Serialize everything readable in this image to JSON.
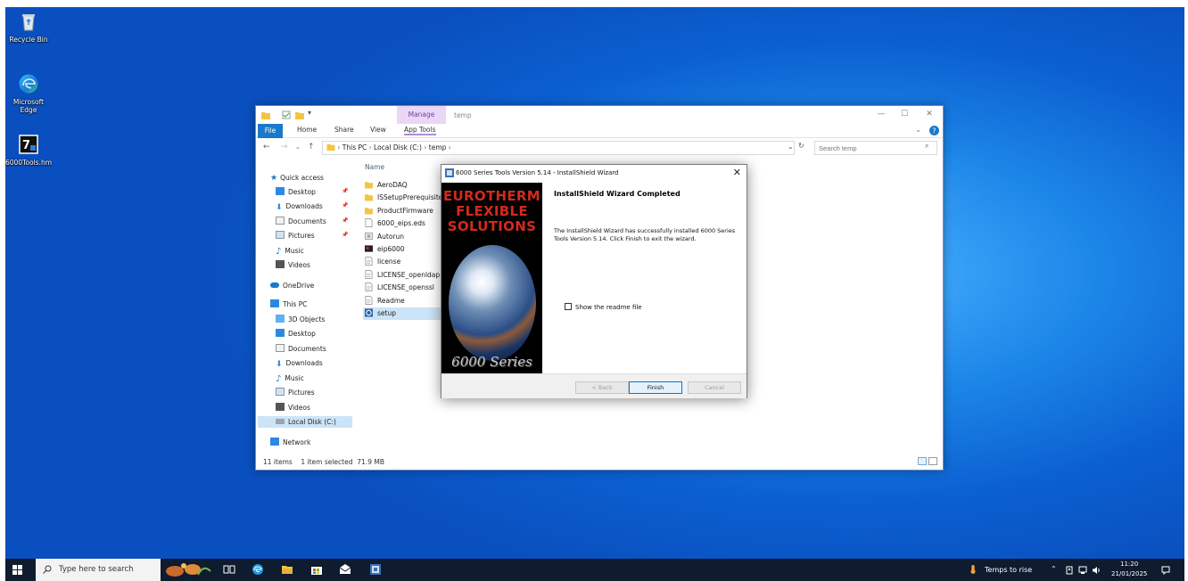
{
  "desktop": {
    "icons": [
      {
        "label": "Recycle Bin",
        "icon": "recycle-bin-icon"
      },
      {
        "label": "Microsoft Edge",
        "icon": "edge-icon"
      },
      {
        "label": "6000Tools.hm",
        "icon": "tools-shortcut-icon"
      }
    ]
  },
  "explorer": {
    "context_tab": "Manage",
    "title": "temp",
    "ribbon_tabs": [
      "File",
      "Home",
      "Share",
      "View",
      "App Tools"
    ],
    "breadcrumb": [
      "This PC",
      "Local Disk (C:)",
      "temp"
    ],
    "search_placeholder": "Search temp",
    "nav": {
      "quick_access": "Quick access",
      "quick_items": [
        "Desktop",
        "Downloads",
        "Documents",
        "Pictures",
        "Music",
        "Videos"
      ],
      "onedrive": "OneDrive",
      "this_pc": "This PC",
      "pc_items": [
        "3D Objects",
        "Desktop",
        "Documents",
        "Downloads",
        "Music",
        "Pictures",
        "Videos",
        "Local Disk (C:)"
      ],
      "network": "Network"
    },
    "column_name": "Name",
    "files": [
      {
        "name": "AeroDAQ",
        "type": "folder"
      },
      {
        "name": "ISSetupPrerequisites",
        "type": "folder"
      },
      {
        "name": "ProductFirmware",
        "type": "folder"
      },
      {
        "name": "6000_eips.eds",
        "type": "file"
      },
      {
        "name": "Autorun",
        "type": "autorun"
      },
      {
        "name": "eip6000",
        "type": "app"
      },
      {
        "name": "license",
        "type": "text"
      },
      {
        "name": "LICENSE_openldap",
        "type": "text"
      },
      {
        "name": "LICENSE_openssl",
        "type": "text"
      },
      {
        "name": "Readme",
        "type": "text"
      },
      {
        "name": "setup",
        "type": "setup",
        "selected": true
      }
    ],
    "status": {
      "items": "11 items",
      "selected": "1 item selected",
      "size": "71.9 MB"
    }
  },
  "wizard": {
    "title": "6000 Series Tools Version 5.14 - InstallShield Wizard",
    "brand_lines": [
      "EUROTHERM",
      "FLEXIBLE",
      "SOLUTIONS"
    ],
    "series_text": "6000 Series",
    "heading": "InstallShield Wizard Completed",
    "body": "The InstallShield Wizard has successfully installed 6000 Series Tools Version 5.14. Click Finish to exit the wizard.",
    "checkbox_label": "Show the readme file",
    "buttons": {
      "back": "< Back",
      "finish": "Finish",
      "cancel": "Cancel"
    }
  },
  "taskbar": {
    "search_placeholder": "Type here to search",
    "weather": "Temps to rise",
    "time": "11:20",
    "date": "21/01/2025"
  },
  "colors": {
    "desktop": "#0b5fd0",
    "accent": "#0078d7",
    "brand_red": "#d32a1e",
    "taskbar": "#0f1b2e"
  }
}
